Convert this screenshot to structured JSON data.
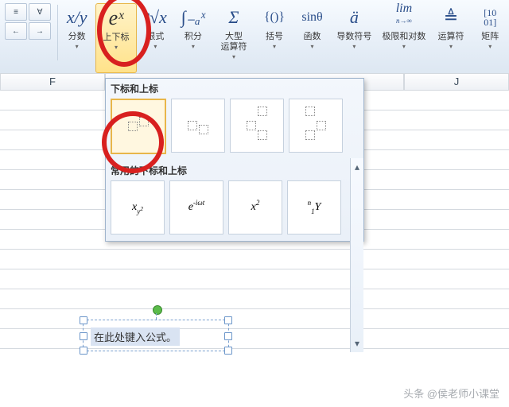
{
  "ribbon": {
    "groups": {
      "fraction_label": "分数",
      "script_label": "上下标",
      "radical_label": "根式",
      "integral_label": "积分",
      "largeop_label": "大型\n运算符",
      "bracket_label": "括号",
      "function_label": "函数",
      "derivative_label": "导数符号",
      "limit_label": "极限和对数",
      "operator_label": "运算符",
      "matrix_label": "矩阵"
    },
    "icons": {
      "fraction": "x/y",
      "script": "eˣ",
      "radical": "ⁿ√x",
      "integral": "∫₋ₐˣ",
      "largeop": "Σ",
      "bracket": "{()}",
      "function": "sinθ",
      "derivative": "ä",
      "limit": "lim",
      "limit_sub": "n→∞",
      "operator": "≜",
      "matrix": "[10\n01]"
    },
    "tool_syms": [
      "≡",
      "∀",
      "←",
      "→"
    ]
  },
  "gallery": {
    "section1_title": "下标和上标",
    "section2_title": "常用的下标和上标",
    "common": [
      "x_{y²}",
      "e^{-iωt}",
      "x²",
      "ⁿ₁Y"
    ]
  },
  "sheet": {
    "cols": [
      "F",
      "J"
    ]
  },
  "equation_box": {
    "placeholder": "在此处键入公式。"
  },
  "watermark": "头条 @侯老师小课堂"
}
